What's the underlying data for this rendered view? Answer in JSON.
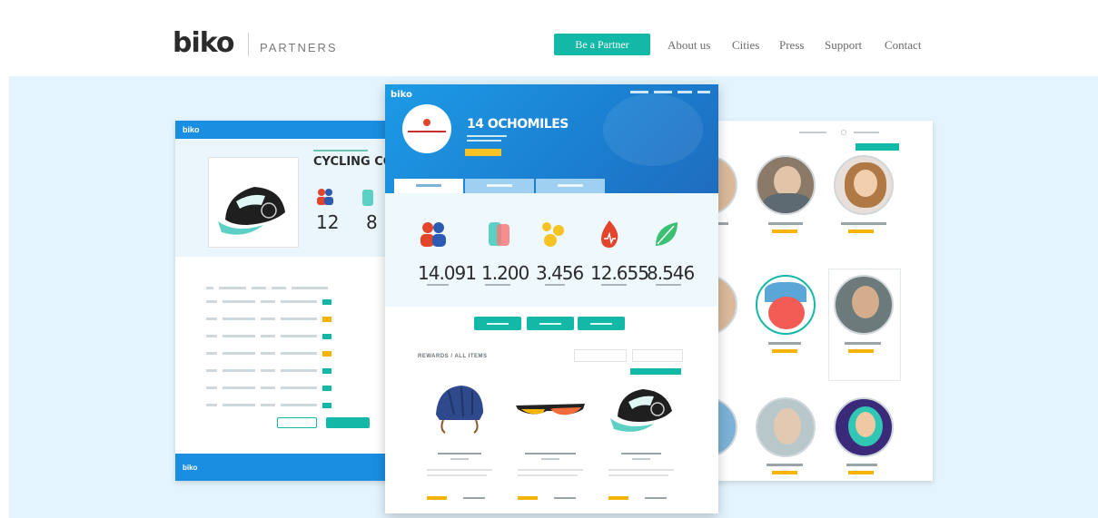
{
  "header": {
    "logo": "biko",
    "logo_sub": "PARTNERS",
    "cta_label": "Be a Partner",
    "nav": [
      "About us",
      "Cities",
      "Press",
      "Support",
      "Contact"
    ]
  },
  "left_card": {
    "brand": "biko",
    "title": "CYCLING COTTON",
    "stats": [
      "12",
      "8"
    ],
    "footer_brand": "biko"
  },
  "center_card": {
    "brand": "biko",
    "title": "14 OCHOMILES",
    "stats": [
      "14.091",
      "1.200",
      "3.456",
      "12.655",
      "8.546"
    ],
    "section_title": "REWARDS / ALL ITEMS"
  },
  "colors": {
    "accent": "#14b8a6",
    "primary_blue": "#1a8ee0",
    "hero_bg": "#e4f4fd",
    "star": "#f5b400",
    "red": "#e2452b"
  }
}
